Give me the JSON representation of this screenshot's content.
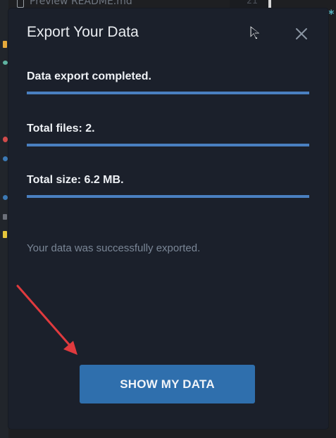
{
  "background": {
    "tab_label": "Preview README.md",
    "line_number": "21"
  },
  "dialog": {
    "title": "Export Your Data",
    "close_glyph": "✕",
    "lines": [
      {
        "text": "Data export completed."
      },
      {
        "text": "Total files: 2."
      },
      {
        "text": "Total size: 6.2 MB."
      }
    ],
    "message": "Your data was successfully exported.",
    "primary_button": "SHOW MY DATA"
  },
  "colors": {
    "dialog_bg": "#1b202b",
    "accent": "#4a7fc0",
    "button_bg": "#2f6fad",
    "annotation_arrow": "#e03a3e"
  },
  "icons": {
    "cursor": "mouse-pointer-icon",
    "close": "close-icon",
    "annotation": "red-arrow-annotation"
  }
}
